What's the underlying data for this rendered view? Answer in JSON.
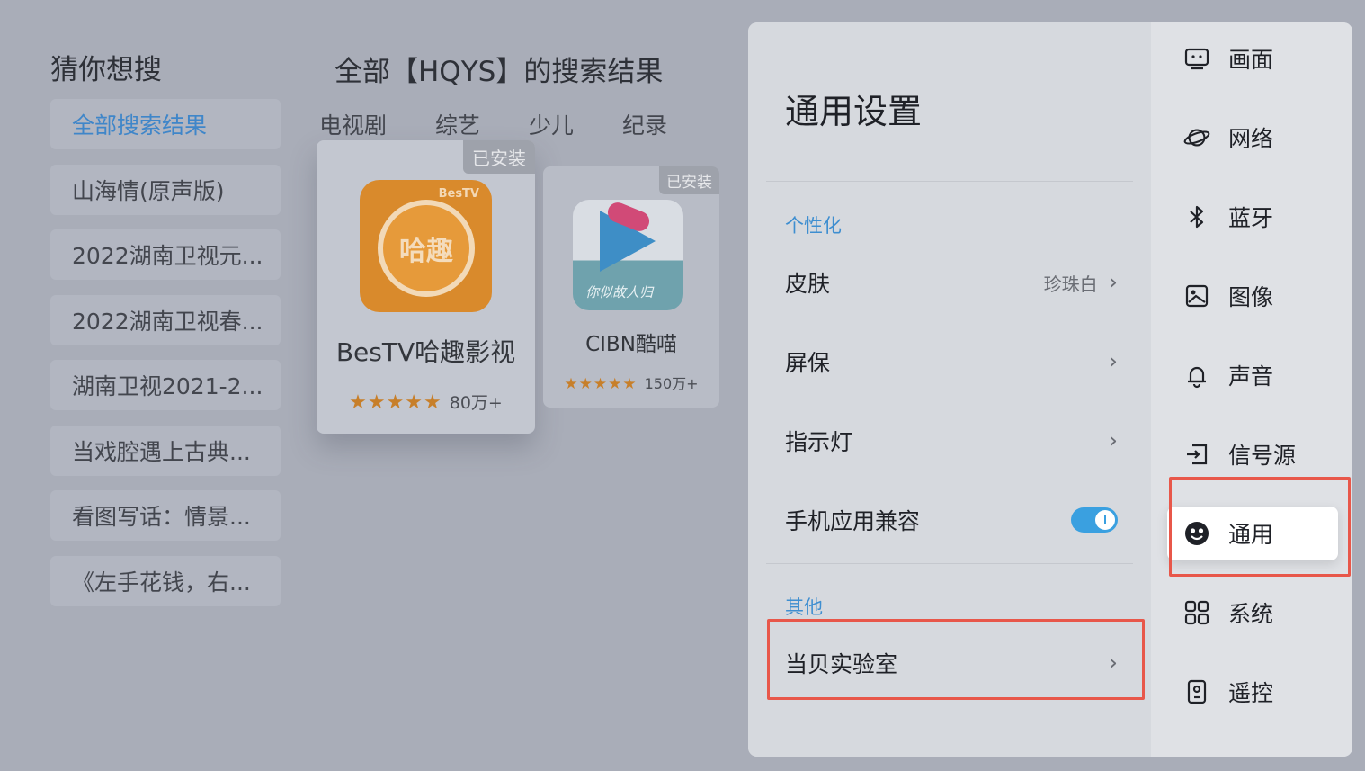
{
  "search": {
    "guess_title": "猜你想搜",
    "result_title": "全部【HQYS】的搜索结果",
    "suggestions": [
      "全部搜索结果",
      "山海情(原声版)",
      "2022湖南卫视元...",
      "2022湖南卫视春...",
      "湖南卫视2021-2...",
      "当戏腔遇上古典...",
      "看图写话：情景...",
      "《左手花钱，右..."
    ],
    "categories": [
      "电视剧",
      "综艺",
      "少儿",
      "纪录"
    ]
  },
  "apps": [
    {
      "badge": "已安装",
      "icon_text": "哈趣",
      "brand": "BesTV",
      "name": "BesTV哈趣影视",
      "stars": "★★★★★",
      "count": "80万+"
    },
    {
      "badge": "已安装",
      "icon_script": "你似故人归",
      "name": "CIBN酷喵",
      "stars": "★★★★★",
      "count": "150万+"
    }
  ],
  "settings": {
    "title": "通用设置",
    "section_personal": "个性化",
    "section_other": "其他",
    "rows": {
      "skin": {
        "label": "皮肤",
        "value": "珍珠白"
      },
      "screensaver": {
        "label": "屏保"
      },
      "indicator": {
        "label": "指示灯"
      },
      "compat": {
        "label": "手机应用兼容",
        "enabled": true
      },
      "lab": {
        "label": "当贝实验室"
      }
    },
    "chevron": "›"
  },
  "nav": {
    "items": [
      {
        "label": "画面",
        "icon": "picture-mode-icon"
      },
      {
        "label": "网络",
        "icon": "planet-network-icon"
      },
      {
        "label": "蓝牙",
        "icon": "bluetooth-icon"
      },
      {
        "label": "图像",
        "icon": "image-icon"
      },
      {
        "label": "声音",
        "icon": "bell-sound-icon"
      },
      {
        "label": "信号源",
        "icon": "input-source-icon"
      },
      {
        "label": "通用",
        "icon": "smiley-general-icon",
        "active": true
      },
      {
        "label": "系统",
        "icon": "grid-system-icon"
      },
      {
        "label": "遥控",
        "icon": "remote-icon"
      }
    ]
  },
  "colors": {
    "accent": "#3e8ed0",
    "highlight_box": "#e8574a",
    "toggle_on": "#3aa0e0"
  }
}
